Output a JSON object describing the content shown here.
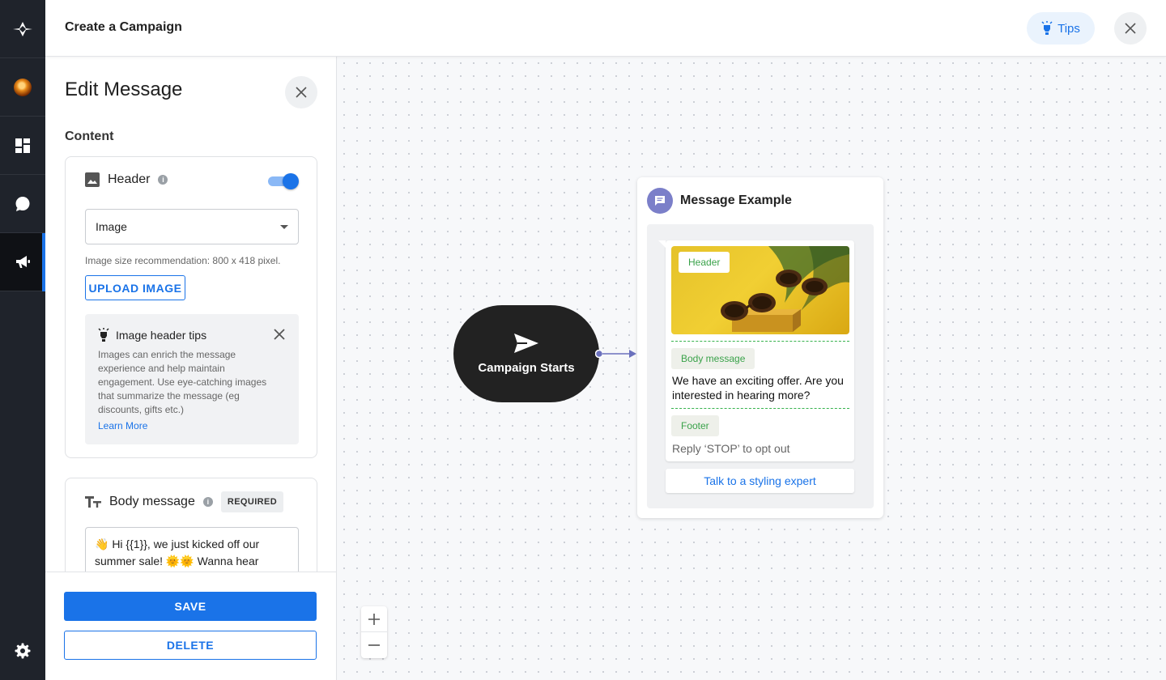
{
  "app": {
    "page_title": "Create a Campaign",
    "tips_label": "Tips"
  },
  "nav": {
    "items": [
      {
        "name": "logo",
        "icon": "logo-icon",
        "active": false
      },
      {
        "name": "account-avatar",
        "icon": "avatar",
        "active": false
      },
      {
        "name": "dashboard",
        "icon": "dashboard-icon",
        "active": false
      },
      {
        "name": "conversations",
        "icon": "chat-icon",
        "active": false
      },
      {
        "name": "campaigns",
        "icon": "megaphone-icon",
        "active": true
      },
      {
        "name": "settings",
        "icon": "gear-icon",
        "active": false
      }
    ]
  },
  "edit_panel": {
    "title": "Edit Message",
    "section_label": "Content",
    "header_card": {
      "title": "Header",
      "enabled": true,
      "type_select": {
        "value": "Image"
      },
      "hint": "Image size recommendation: 800 x 418 pixel.",
      "upload_label": "UPLOAD IMAGE",
      "tips": {
        "title": "Image header tips",
        "text": "Images can enrich the message experience and help maintain engagement. Use eye-catching images that summarize the message (eg discounts, gifts etc.)",
        "link": "Learn More"
      }
    },
    "body_card": {
      "title": "Body message",
      "badge": "REQUIRED",
      "value": "👋 Hi {{1}}, we just kicked off our summer sale! 🌞🌞 Wanna hear"
    },
    "save_label": "SAVE",
    "delete_label": "DELETE"
  },
  "canvas": {
    "start_node": {
      "label": "Campaign Starts"
    },
    "message_card": {
      "title": "Message Example",
      "header_tag": "Header",
      "body_tag": "Body message",
      "body_text": "We have an exciting offer. Are you interested in hearing more?",
      "footer_tag": "Footer",
      "footer_text": "Reply ‘STOP’ to opt out",
      "cta_label": "Talk to a styling expert"
    }
  },
  "colors": {
    "accent": "#1a73e8",
    "rail_bg": "#1f232b",
    "tag_green": "#3aa24a",
    "message_icon": "#7b7fc9"
  }
}
